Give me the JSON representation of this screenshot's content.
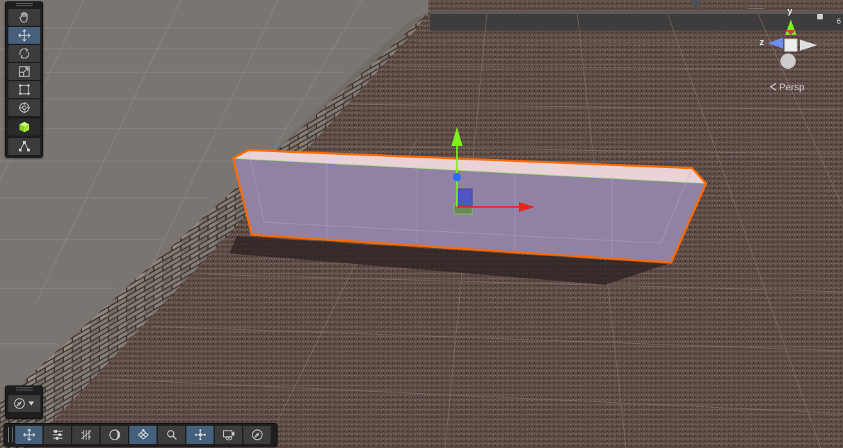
{
  "scene_view": {
    "camera_mode_label": "Persp",
    "axis_labels": {
      "y": "y",
      "z": "z"
    },
    "gizmo_partial_text": "6",
    "colors": {
      "selection_outline": "#ff6a00",
      "x_axis": "#e8241c",
      "y_axis": "#7cf21a",
      "z_axis": "#2a6cff",
      "tool_active": "#46607c",
      "toolbar_bg": "#1e1e1e"
    }
  },
  "tools_overlay": {
    "items": [
      {
        "icon": "hand-icon",
        "name": "view-tool",
        "active": false
      },
      {
        "icon": "move-icon",
        "name": "move-tool",
        "active": true
      },
      {
        "icon": "rotate-icon",
        "name": "rotate-tool",
        "active": false
      },
      {
        "icon": "scale-icon",
        "name": "scale-tool",
        "active": false
      },
      {
        "icon": "rect-icon",
        "name": "rect-tool",
        "active": false
      },
      {
        "icon": "transform-icon",
        "name": "transform-tool",
        "active": false
      },
      {
        "icon": "cube-icon",
        "name": "custom-editor-tool",
        "active": false
      },
      {
        "icon": "probuilder-icon",
        "name": "component-tool",
        "active": false
      }
    ]
  },
  "orientation_overlay": {
    "icon": "compass-icon",
    "dropdown_icon": "dropdown-arrow-icon"
  },
  "bottom_overlay": {
    "items": [
      {
        "icon": "move-icon",
        "active": true
      },
      {
        "icon": "sliders-icon",
        "active": false
      },
      {
        "icon": "grid-snap-icon",
        "active": false
      },
      {
        "icon": "shading-icon",
        "active": false
      },
      {
        "icon": "grid-plane-icon",
        "active": true
      },
      {
        "icon": "search-icon",
        "active": false
      },
      {
        "icon": "pivot-icon",
        "active": true
      },
      {
        "icon": "camera-icon",
        "active": false
      },
      {
        "icon": "compass-icon",
        "active": false
      }
    ]
  }
}
